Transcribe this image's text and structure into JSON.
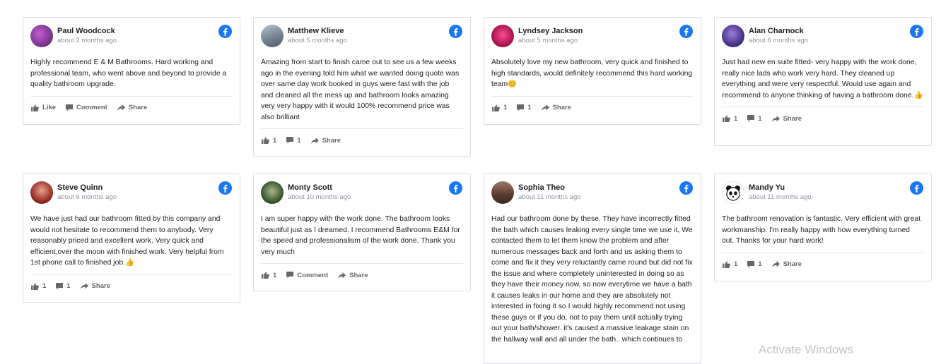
{
  "reviews": [
    {
      "name": "Paul Woodcock",
      "time": "about 2 months ago",
      "text": "Highly recommend E & M Bathrooms. Hard working and professional team, who went above and beyond to provide a quality bathroom upgrade.",
      "like": "Like",
      "comment": "Comment",
      "share": "Share",
      "avatar": "#7b3a8c"
    },
    {
      "name": "Matthew Klieve",
      "time": "about 5 months ago",
      "text": "Amazing from start to finish came out to see us a few weeks ago in the evening told him what we wanted doing quote was over same day work booked in guys were fast with the job and cleaned all the mess up and bathroom looks amazing very very happy with it would 100% recommend price was also brilliant",
      "like": "1",
      "comment": "1",
      "share": "Share",
      "avatar": "#8a9aa8"
    },
    {
      "name": "Lyndsey Jackson",
      "time": "about 5 months ago",
      "text": "Absolutely love my new bathroom, very quick and finished to high standards, would definitely recommend this hard working team😊",
      "like": "1",
      "comment": "1",
      "share": "Share",
      "avatar": "#c2185b"
    },
    {
      "name": "Alan Charnock",
      "time": "about 6 months ago",
      "text": "Just had new en suite fitted- very happy with the work done, really nice lads who work very hard. They cleaned up everything and were very respectful. Would use again and recommend to anyone thinking of having a bathroom done.👍",
      "like": "1",
      "comment": "1",
      "share": "Share",
      "avatar": "#5a3fa0"
    },
    {
      "name": "Steve Quinn",
      "time": "about 6 months ago",
      "text": "We have just had our bathroom fitted by this company and would not hesitate to recommend them to anybody. Very reasonably priced and excellent work. Very quick and efficient,over the moon with finished work. Very helpful from 1st phone call to finished job.👍",
      "like": "1",
      "comment": "1",
      "share": "Share",
      "avatar": "#b23a2e"
    },
    {
      "name": "Monty Scott",
      "time": "about 10 months ago",
      "text": "I am super happy with the work done. The bathroom looks beautiful just as I dreamed. I recommend Bathrooms E&M for the speed and professionalism of the work done. Thank you very much",
      "like": "1",
      "comment": "Comment",
      "share": "Share",
      "avatar": "#4a6a3a"
    },
    {
      "name": "Sophia Theo",
      "time": "about 11 months ago",
      "text": "Had our bathroom done by these. They have incorrectly fitted the bath which causes leaking every single time we use it, We contacted them to let them know the problem and after numerous messages back and forth and us asking them to come and fix it they very reluctantly came round but did not fix the issue and where completely uninterested in doing so as they have their money now, so now everytime we have a bath it causes leaks in our home and they are absolutely not interested in fixing it so I would highly recommend not using these guys or if you do, not to pay them until actually trying out your bath/shower. it's caused a massive leakage stain on the hallway wall and all under the bath.. which continues to",
      "like": "",
      "comment": "",
      "share": "",
      "avatar": "#6b4a3a"
    },
    {
      "name": "Mandy Yu",
      "time": "about 11 months ago",
      "text": "The bathroom renovation is fantastic. Very efficient with great workmanship. I'm really happy with how everything turned out. Thanks for your hard work!",
      "like": "1",
      "comment": "1",
      "share": "Share",
      "avatar": "#ffffff"
    }
  ],
  "watermark": "Activate Windows",
  "colors": {
    "facebook": "#1877f2",
    "meta": "#8d949e",
    "action": "#65676b"
  }
}
